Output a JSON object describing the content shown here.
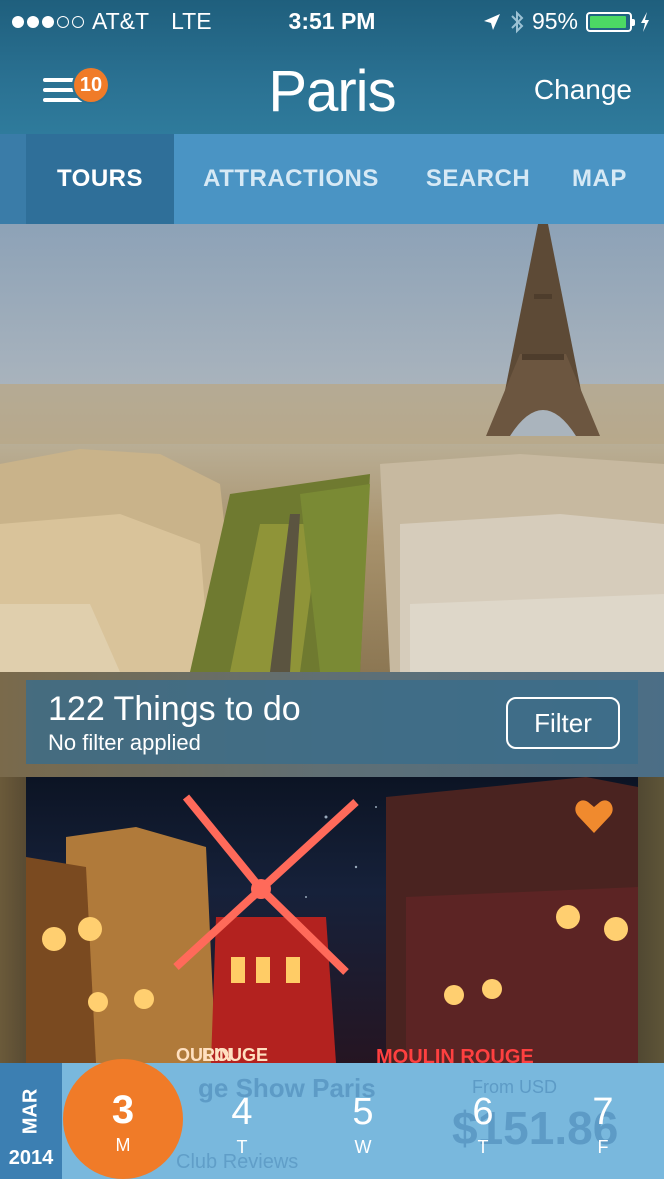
{
  "status_bar": {
    "carrier": "AT&T",
    "network": "LTE",
    "time": "3:51 PM",
    "battery_percent": "95%",
    "battery_level": 0.95,
    "signal_bars": 3,
    "icons": [
      "location-arrow-icon",
      "bluetooth-icon",
      "charging-bolt-icon"
    ]
  },
  "nav": {
    "menu_badge": "10",
    "city": "Paris",
    "change_label": "Change"
  },
  "tabs": [
    {
      "label": "TOURS",
      "active": true
    },
    {
      "label": "ATTRACTIONS",
      "active": false
    },
    {
      "label": "SEARCH",
      "active": false
    },
    {
      "label": "MAP",
      "active": false
    }
  ],
  "listing": {
    "count_title": "122 Things to do",
    "filter_status": "No filter applied",
    "filter_button": "Filter"
  },
  "tour_card": {
    "image_signage": [
      "OULIN",
      "ROUGE",
      "MOULIN ROUGE"
    ],
    "favorite": true,
    "title_partial": "ge Show Paris",
    "price_from_label": "From USD",
    "price_partial": "$151.86",
    "reviews_partial": "Club Reviews"
  },
  "date_strip": {
    "month": "MAR",
    "year": "2014",
    "days": [
      {
        "num": "3",
        "letter": "M",
        "selected": true
      },
      {
        "num": "4",
        "letter": "T",
        "selected": false
      },
      {
        "num": "5",
        "letter": "W",
        "selected": false
      },
      {
        "num": "6",
        "letter": "T",
        "selected": false
      },
      {
        "num": "7",
        "letter": "F",
        "selected": false
      }
    ]
  },
  "colors": {
    "header": "#2a7192",
    "tabs": "#4a94c4",
    "tab_active": "#2f6f99",
    "accent": "#f07b28",
    "date_strip": "#79b8dd",
    "battery": "#4cd964"
  }
}
